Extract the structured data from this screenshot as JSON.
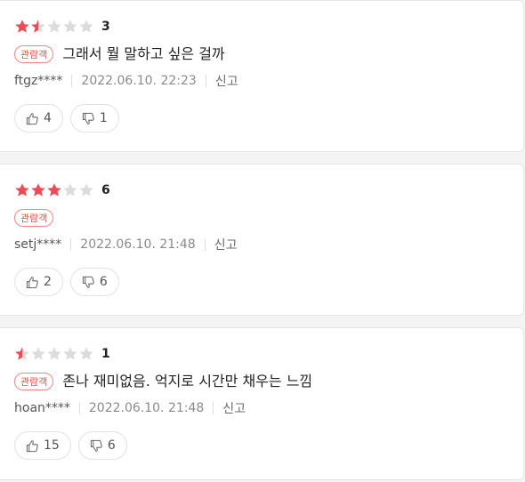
{
  "colors": {
    "star_active": "#ef4a56",
    "star_inactive": "#dcdcdc",
    "badge": "#ef4a43"
  },
  "reviews": [
    {
      "score": "3",
      "score_value": 3,
      "badge": "관람객",
      "comment": "그래서 뭘 말하고 싶은 걸까",
      "user": "ftgz****",
      "date": "2022.06.10. 22:23",
      "report_label": "신고",
      "likes": "4",
      "dislikes": "1"
    },
    {
      "score": "6",
      "score_value": 6,
      "badge": "관람객",
      "comment": "",
      "user": "setj****",
      "date": "2022.06.10. 21:48",
      "report_label": "신고",
      "likes": "2",
      "dislikes": "6"
    },
    {
      "score": "1",
      "score_value": 1,
      "badge": "관람객",
      "comment": "존나 재미없음. 억지로 시간만 채우는 느낌",
      "user": "hoan****",
      "date": "2022.06.10. 21:48",
      "report_label": "신고",
      "likes": "15",
      "dislikes": "6"
    }
  ]
}
